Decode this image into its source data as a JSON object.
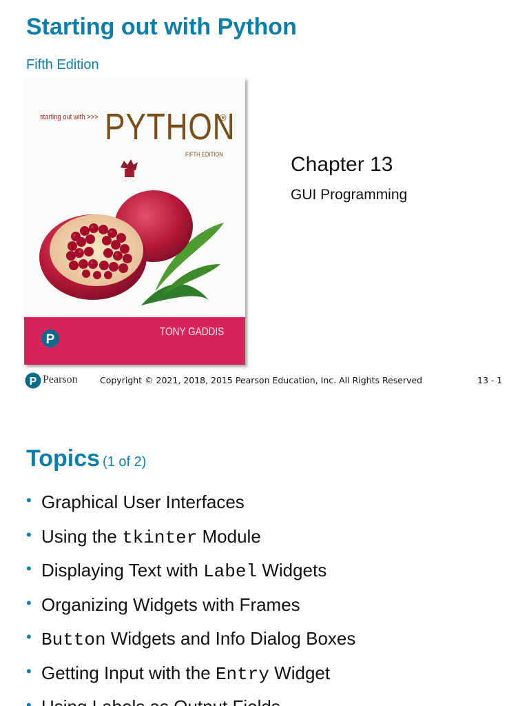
{
  "slide1": {
    "title": "Starting out with Python",
    "subtitle": "Fifth Edition",
    "cover": {
      "small_text": "starting out with >>>",
      "big_title": "PYTHON",
      "registered": "®",
      "edition": "FIFTH EDITION",
      "author": "TONY GADDIS",
      "colors": {
        "band": "#d8245a",
        "title": "#7a4d1d"
      }
    },
    "chapter": "Chapter 13",
    "chapter_subtitle": "GUI Programming",
    "footer": {
      "brand": "Pearson",
      "copyright": "Copyright © 2021, 2018, 2015 Pearson Education, Inc. All Rights Reserved",
      "page": "13 - 1"
    }
  },
  "slide2": {
    "title": "Topics",
    "count": "(1 of 2)",
    "items": [
      {
        "pre": "Graphical User Interfaces",
        "code": "",
        "post": ""
      },
      {
        "pre": "Using the ",
        "code": "tkinter",
        "post": " Module"
      },
      {
        "pre": "Displaying Text with ",
        "code": "Label",
        "post": " Widgets"
      },
      {
        "pre": "Organizing Widgets with Frames",
        "code": "",
        "post": ""
      },
      {
        "pre": "",
        "code": "Button",
        "post": " Widgets and Info Dialog Boxes"
      },
      {
        "pre": "Getting Input with the ",
        "code": "Entry",
        "post": " Widget"
      },
      {
        "pre": "Using Labels as Output Fields",
        "code": "",
        "post": ""
      }
    ]
  },
  "theme": {
    "accent": "#0c7fa9"
  }
}
